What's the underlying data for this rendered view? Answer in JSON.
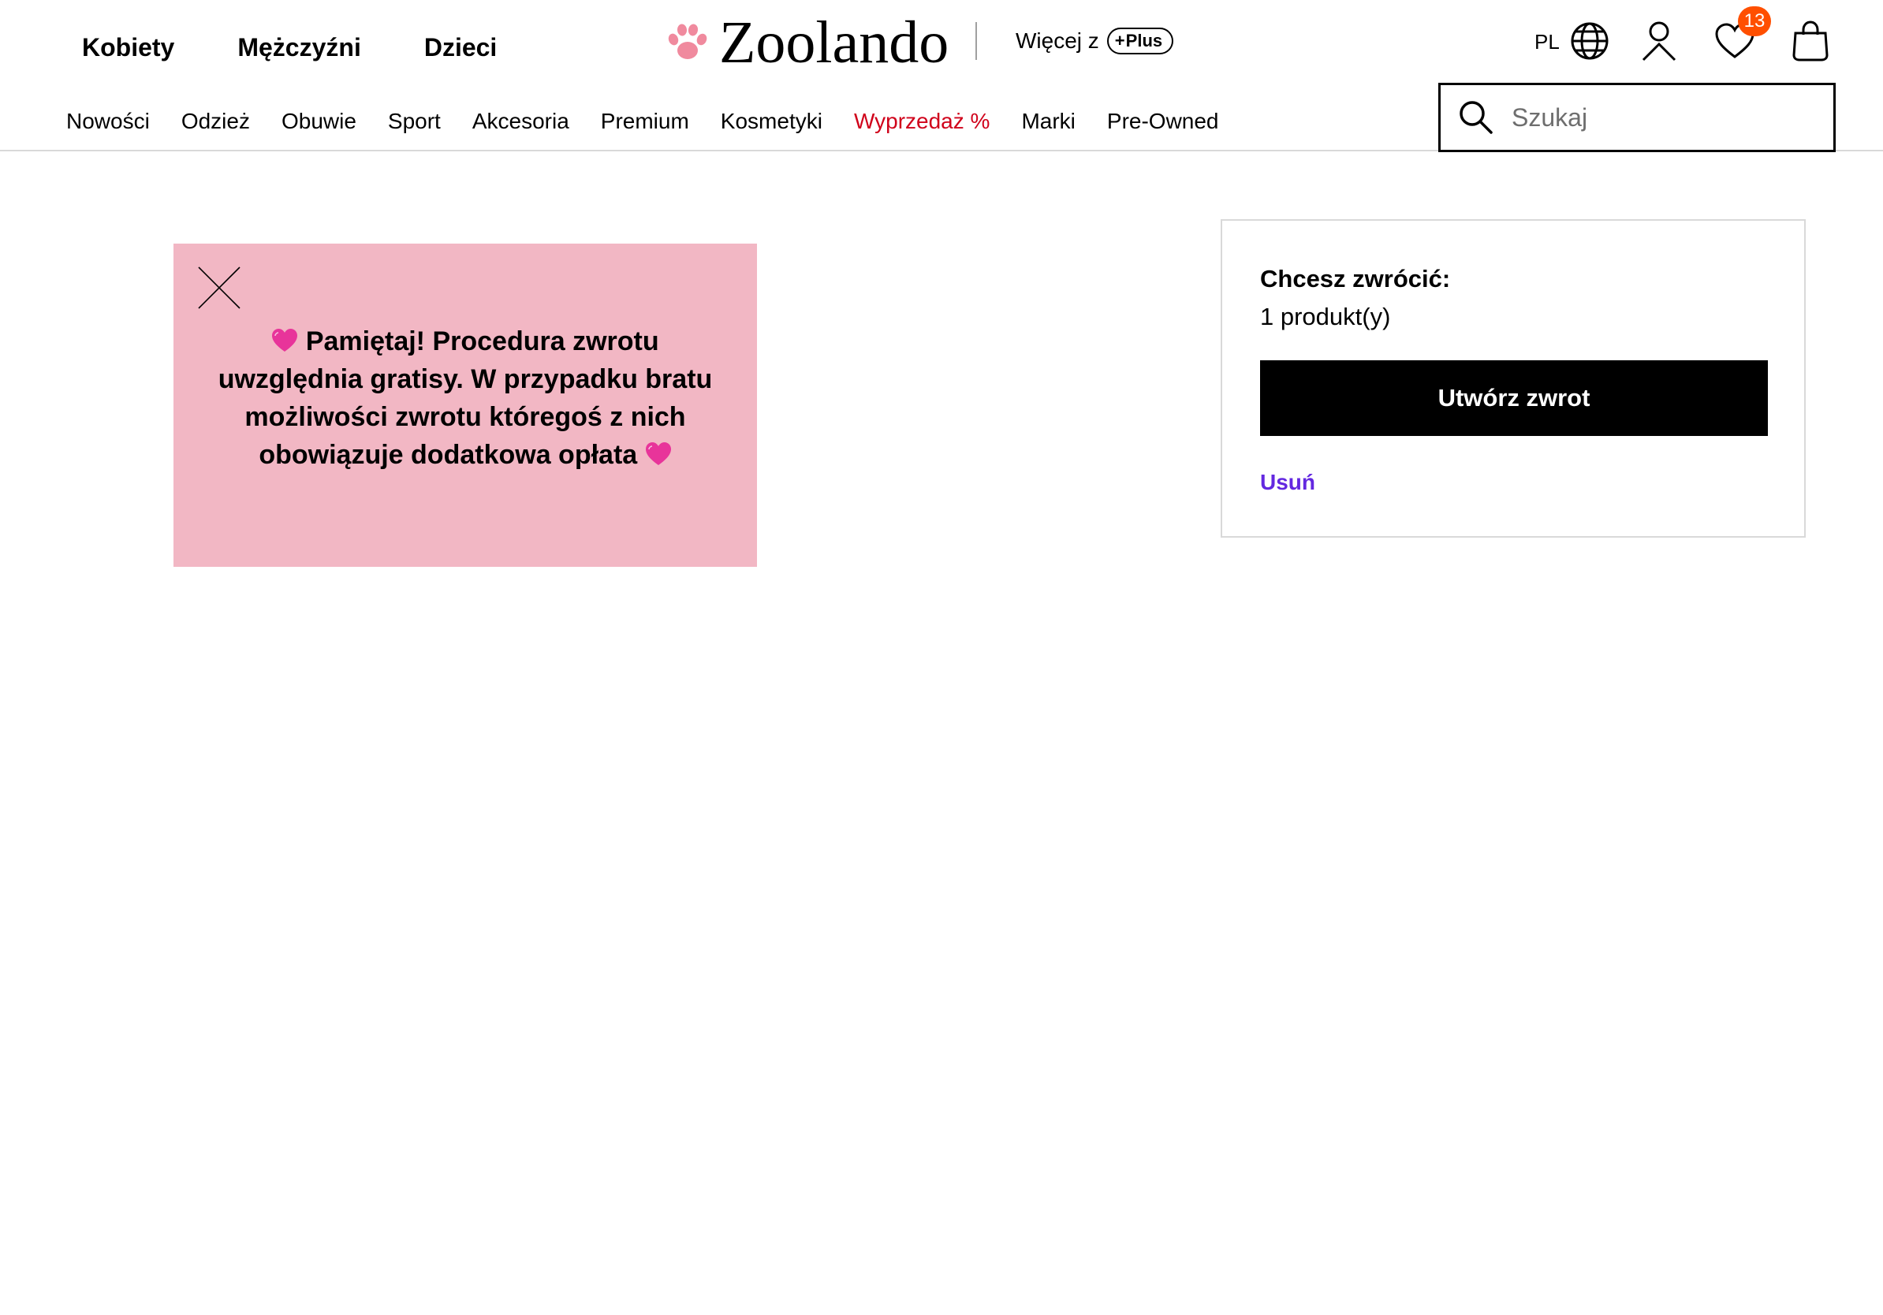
{
  "header": {
    "target_groups": [
      "Kobiety",
      "Mężczyźni",
      "Dzieci"
    ],
    "logo_text": "Zoolando",
    "more_with_label": "Więcej z",
    "plus_label": "Plus",
    "language_label": "PL",
    "wishlist_count": "13",
    "categories": [
      "Nowości",
      "Odzież",
      "Obuwie",
      "Sport",
      "Akcesoria",
      "Premium",
      "Kosmetyki",
      "Wyprzedaż %",
      "Marki",
      "Pre-Owned"
    ],
    "sale_color": "#d0021b",
    "search": {
      "placeholder": "Szukaj",
      "value": ""
    }
  },
  "promo_banner": {
    "text": "Pamiętaj! Procedura zwrotu uwzględnia gratisy. W przypadku bratu możliwości zwrotu któregoś  z nich obowiązuje dodatkowa opłata",
    "background_color": "#f2b7c4",
    "icons": [
      "close-icon",
      "heart-icon"
    ]
  },
  "return_panel": {
    "title": "Chcesz zwrócić:",
    "count_text": "1 produkt(y)",
    "create_button_label": "Utwórz zwrot",
    "remove_label": "Usuń",
    "remove_color": "#6328e0"
  },
  "icons": {
    "logo": "paw-icon",
    "language": "globe-icon",
    "account": "user-icon",
    "wishlist": "heart-outline-icon",
    "cart": "shopping-bag-icon",
    "search": "search-icon",
    "badge_color": "#ff4f00"
  }
}
